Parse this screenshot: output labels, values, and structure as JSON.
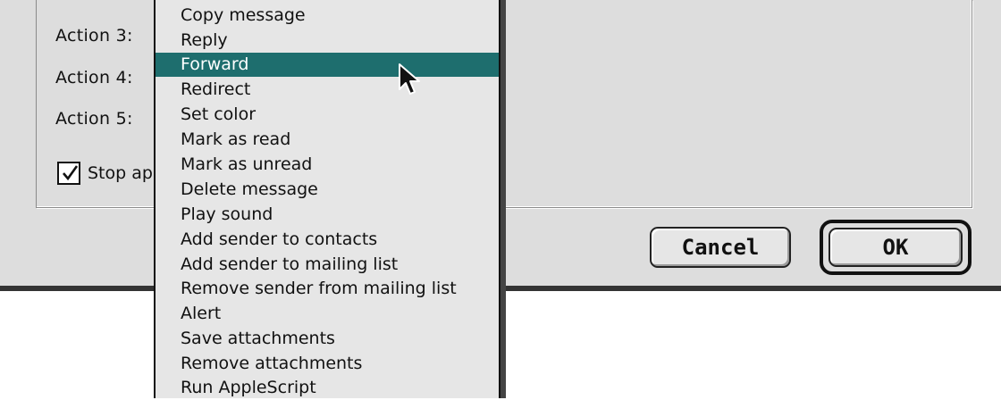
{
  "dialog": {
    "action_labels": [
      "Action 3:",
      "Action 4:",
      "Action 5:"
    ],
    "stop_checkbox": {
      "label": "Stop ap",
      "checked": true
    },
    "cancel_label": "Cancel",
    "ok_label": "OK"
  },
  "menu": {
    "selected_index": 2,
    "highlight_color": "#1e6e6e",
    "items": [
      "Copy message",
      "Reply",
      "Forward",
      "Redirect",
      "Set color",
      "Mark as read",
      "Mark as unread",
      "Delete message",
      "Play sound",
      "Add sender to contacts",
      "Add sender to mailing list",
      "Remove sender from mailing list",
      "Alert",
      "Save attachments",
      "Remove attachments",
      "Run AppleScript"
    ]
  },
  "cursor": {
    "icon": "arrow-pointer-icon"
  }
}
